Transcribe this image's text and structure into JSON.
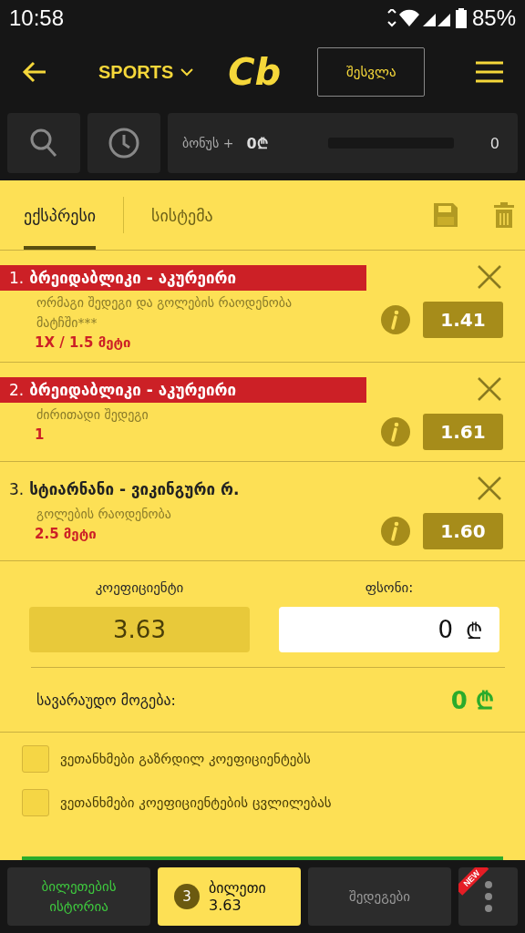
{
  "status_bar": {
    "time": "10:58",
    "battery": "85%"
  },
  "header": {
    "sport": "SPORTS",
    "logo": "Cb",
    "login": "შესვლა"
  },
  "toolbar": {
    "bonus_label": "ბონუს +",
    "bonus_amount": "0₾",
    "bonus_count": "0"
  },
  "tabs": [
    {
      "label": "ექსპრესი",
      "selected": true
    },
    {
      "label": "სისტემა",
      "selected": false
    }
  ],
  "bets": [
    {
      "number": "1.",
      "match": "ბრეიდაბლიკი - აკურეირი",
      "highlighted": true,
      "market": "ორმაგი შედეგი და გოლების რაოდენობა მატჩში***",
      "pick": "1X / 1.5 მეტი",
      "odds": "1.41"
    },
    {
      "number": "2.",
      "match": "ბრეიდაბლიკი - აკურეირი",
      "highlighted": true,
      "market": "ძირითადი შედეგი",
      "pick": "1",
      "odds": "1.61"
    },
    {
      "number": "3.",
      "match": "სტიარნანი - ვიკინგური რ.",
      "highlighted": false,
      "market": "გოლების რაოდენობა",
      "pick": "2.5 მეტი",
      "odds": "1.60"
    }
  ],
  "summary": {
    "odds_label": "კოეფიციენტი",
    "odds": "3.63",
    "stake_label": "ფსონი:",
    "stake": "0",
    "currency": "₾",
    "win_label": "სავარაუდო მოგება:",
    "win": "0 ₾"
  },
  "agreements": [
    {
      "label": "ვეთანხმები გაზრდილ კოეფიციენტებს",
      "checked": false
    },
    {
      "label": "ვეთანხმები კოეფიციენტების ცვლილებას",
      "checked": false
    }
  ],
  "bottom_nav": {
    "history": "ბილეთების ისტორია",
    "ticket_count": "3",
    "ticket": "ბილეთი",
    "ticket_odds": "3.63",
    "results": "შედეგები",
    "badge": "NEW"
  }
}
